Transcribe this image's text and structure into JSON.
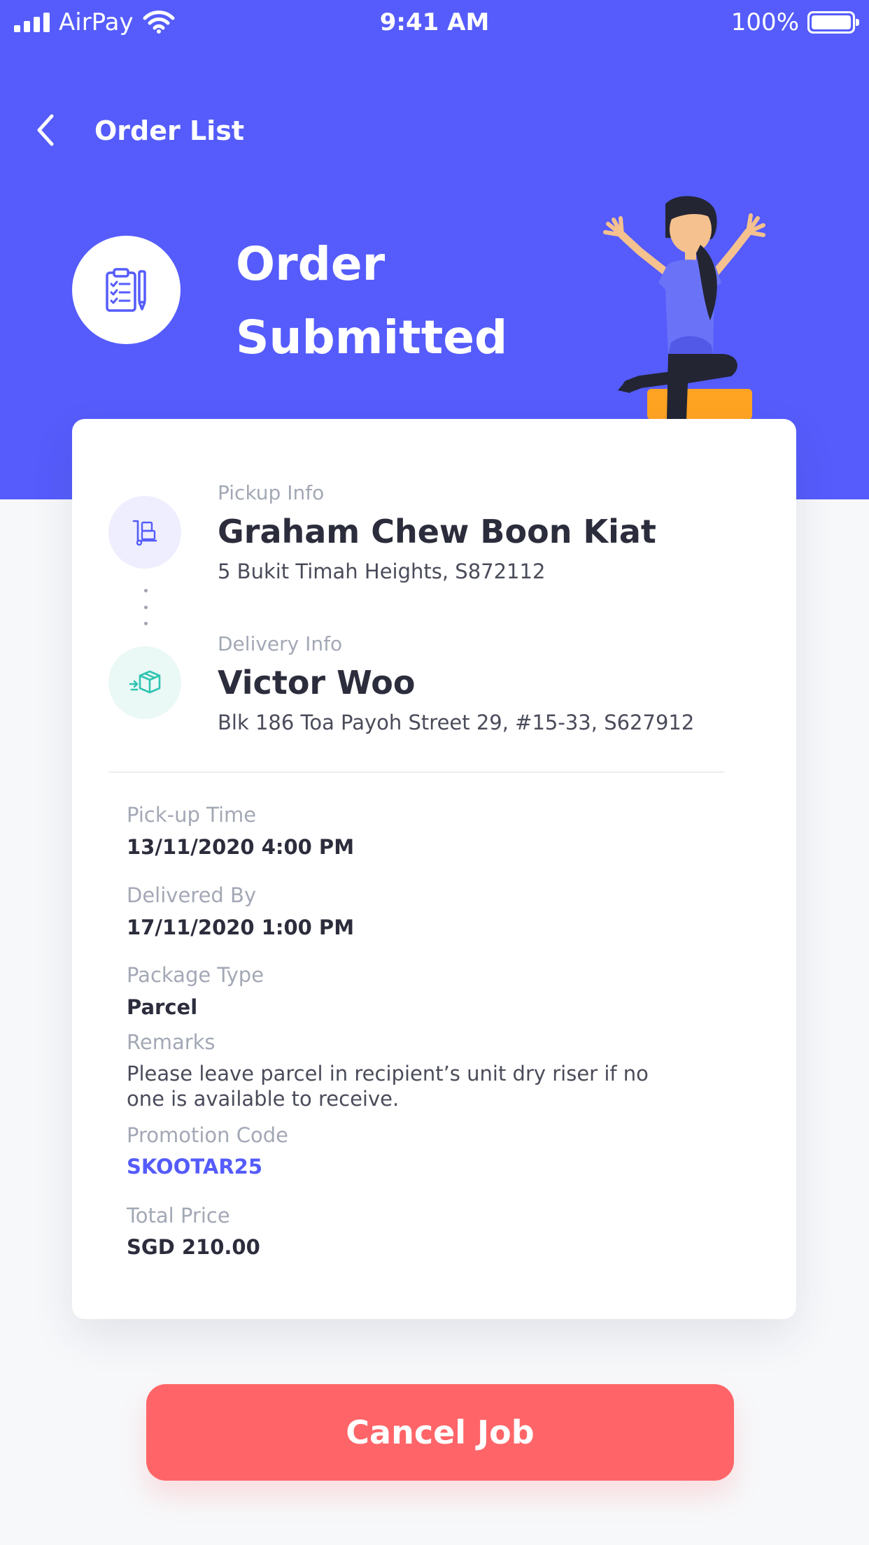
{
  "status_bar": {
    "carrier": "AirPay",
    "time": "9:41 AM",
    "battery": "100%"
  },
  "nav": {
    "back_icon": "chevron-left-icon",
    "title": "Order List"
  },
  "hero": {
    "icon": "clipboard-checklist-icon",
    "title_line1": "Order",
    "title_line2": "Submitted"
  },
  "pickup": {
    "icon": "hand-truck-icon",
    "label": "Pickup Info",
    "name": "Graham Chew Boon Kiat",
    "address": "5 Bukit Timah Heights, S872112"
  },
  "delivery": {
    "icon": "package-delivery-icon",
    "label": "Delivery Info",
    "name": "Victor Woo",
    "address": "Blk 186 Toa Payoh Street 29, #15-33, S627912"
  },
  "details": {
    "pickup_time_label": "Pick-up Time",
    "pickup_time": "13/11/2020 4:00 PM",
    "delivered_by_label": "Delivered By",
    "delivered_by": "17/11/2020 1:00 PM",
    "package_type_label": "Package Type",
    "package_type": "Parcel",
    "remarks_label": "Remarks",
    "remarks": "Please leave parcel in recipient’s unit dry riser if no one is available to receive.",
    "promo_label": "Promotion Code",
    "promo_code": "SKOOTAR25",
    "total_label": "Total Price",
    "total": "SGD 210.00"
  },
  "actions": {
    "cancel_label": "Cancel Job"
  },
  "colors": {
    "primary": "#555CFB",
    "danger": "#FF6568",
    "teal": "#2EC4B0",
    "background": "#F7F8FA"
  }
}
